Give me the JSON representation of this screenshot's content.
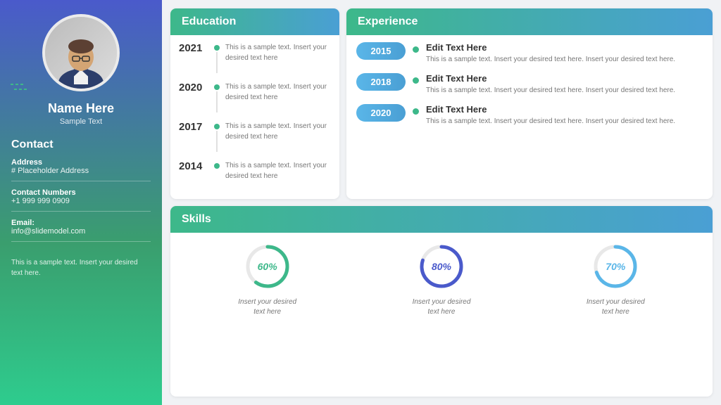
{
  "sidebar": {
    "name": "Name Here",
    "subtitle": "Sample Text",
    "contact_title": "Contact",
    "address_label": "Address",
    "address_value": "# Placeholder Address",
    "phone_label": "Contact Numbers",
    "phone_value": "+1 999 999 0909",
    "email_label": "Email:",
    "email_value": "info@slidemodel.com",
    "footer_text": "This is a sample text. Insert your desired text here."
  },
  "education": {
    "title": "Education",
    "items": [
      {
        "year": "2021",
        "text": "This is a sample text. Insert your desired text here"
      },
      {
        "year": "2020",
        "text": "This is a sample text. Insert your desired text here"
      },
      {
        "year": "2017",
        "text": "This is a sample text. Insert your desired text here"
      },
      {
        "year": "2014",
        "text": "This is a sample text. Insert your desired text here"
      }
    ]
  },
  "experience": {
    "title": "Experience",
    "items": [
      {
        "year": "2015",
        "title": "Edit Text Here",
        "desc": "This is a sample text. Insert your desired text here. Insert your desired text here."
      },
      {
        "year": "2018",
        "title": "Edit Text Here",
        "desc": "This is a sample text. Insert your desired text here. Insert your desired text here."
      },
      {
        "year": "2020",
        "title": "Edit Text Here",
        "desc": "This is a sample text. Insert your desired text here. Insert your desired text here."
      }
    ]
  },
  "skills": {
    "title": "Skills",
    "items": [
      {
        "percent": 60,
        "label": "60%",
        "color": "#3db88a",
        "desc": "Insert your desired\ntext here"
      },
      {
        "percent": 80,
        "label": "80%",
        "color": "#4a5acb",
        "desc": "Insert your desired\ntext here"
      },
      {
        "percent": 70,
        "label": "70%",
        "color": "#5ab6e8",
        "desc": "Insert your desired\ntext here"
      }
    ]
  }
}
